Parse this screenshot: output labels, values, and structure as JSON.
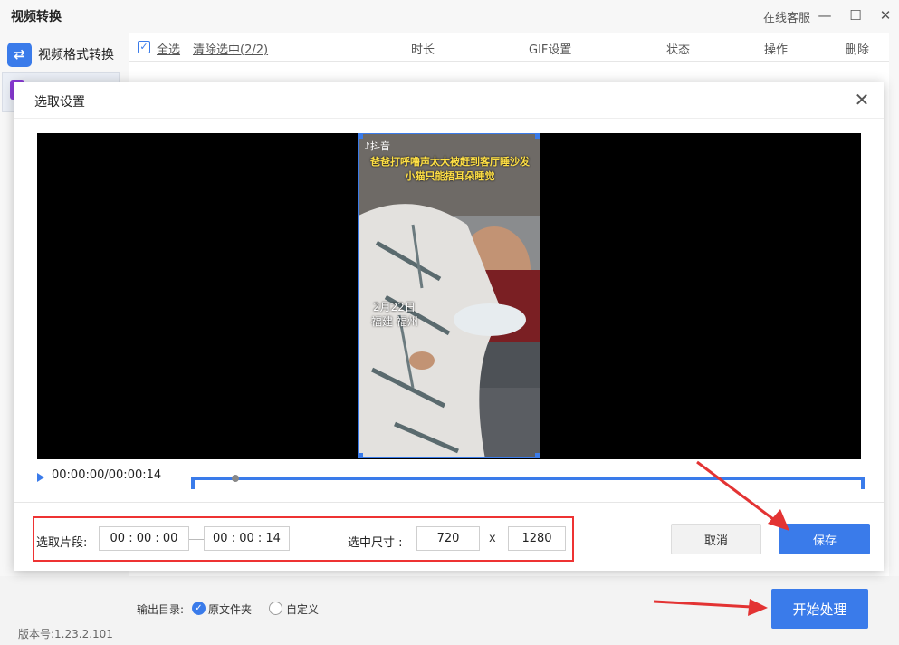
{
  "app": {
    "title": "视频转换",
    "support_label": "在线客服",
    "minimize_glyph": "—",
    "maximize_glyph": "☐",
    "close_glyph": "✕"
  },
  "sidebar": {
    "items": [
      {
        "label": "视频格式转换",
        "icon": "swap-arrows-icon"
      }
    ]
  },
  "list_header": {
    "select_all": "全选",
    "clear_selected": "清除选中(2/2)",
    "duration": "时长",
    "gif_settings": "GIF设置",
    "status": "状态",
    "actions": "操作",
    "delete": "删除"
  },
  "dialog": {
    "title": "选取设置",
    "close_glyph": "✕",
    "video_overlay": {
      "brand": "抖音",
      "caption_line1": "爸爸打呼噜声太大被赶到客厅睡沙发",
      "caption_line2": "小猫只能捂耳朵睡觉",
      "date": "2月22日",
      "location": "福建 福州"
    },
    "time_display": "00:00:00/00:00:14",
    "segment_label": "选取片段:",
    "segment_start": "00 : 00 : 00",
    "segment_end": "00 : 00 : 14",
    "size_label": "选中尺寸 :",
    "width": "720",
    "x_sep": "x",
    "height": "1280",
    "cancel_label": "取消",
    "save_label": "保存"
  },
  "bottom": {
    "output_label": "输出目录:",
    "option_original": "原文件夹",
    "option_custom": "自定义",
    "start_label": "开始处理",
    "version": "版本号:1.23.2.101"
  },
  "colors": {
    "accent": "#3a7bea",
    "annotation_red": "#e33333"
  }
}
